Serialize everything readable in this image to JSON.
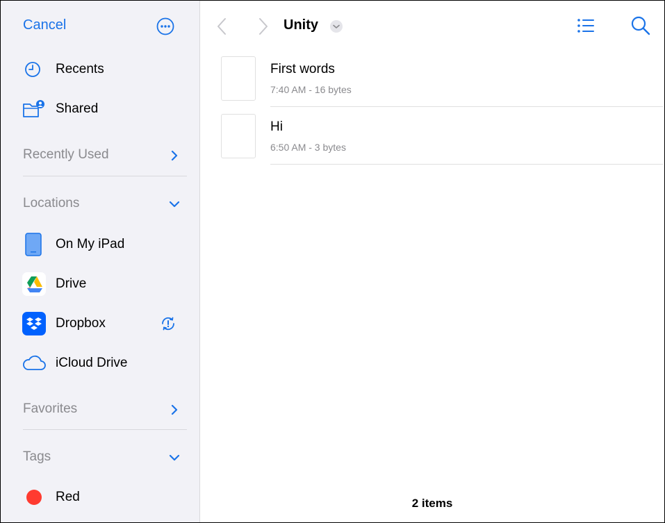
{
  "sidebar": {
    "cancel_label": "Cancel",
    "top_items": [
      {
        "label": "Recents",
        "icon": "clock-icon"
      },
      {
        "label": "Shared",
        "icon": "shared-folder-icon"
      }
    ],
    "recently_used": {
      "label": "Recently Used"
    },
    "locations": {
      "label": "Locations",
      "items": [
        {
          "label": "On My iPad",
          "icon": "ipad-icon"
        },
        {
          "label": "Drive",
          "icon": "google-drive-icon"
        },
        {
          "label": "Dropbox",
          "icon": "dropbox-icon"
        },
        {
          "label": "iCloud Drive",
          "icon": "icloud-icon"
        }
      ]
    },
    "favorites": {
      "label": "Favorites"
    },
    "tags": {
      "label": "Tags",
      "items": [
        {
          "label": "Red",
          "color": "#ff3b30"
        }
      ]
    }
  },
  "main": {
    "folder_title": "Unity",
    "files": [
      {
        "name": "First words",
        "meta": "7:40 AM - 16 bytes"
      },
      {
        "name": "Hi",
        "meta": "6:50 AM - 3 bytes"
      }
    ],
    "item_count": "2 items"
  },
  "colors": {
    "accent": "#1a73e8",
    "sidebar_bg": "#f2f2f7",
    "secondary_text": "#8a8a8e"
  }
}
